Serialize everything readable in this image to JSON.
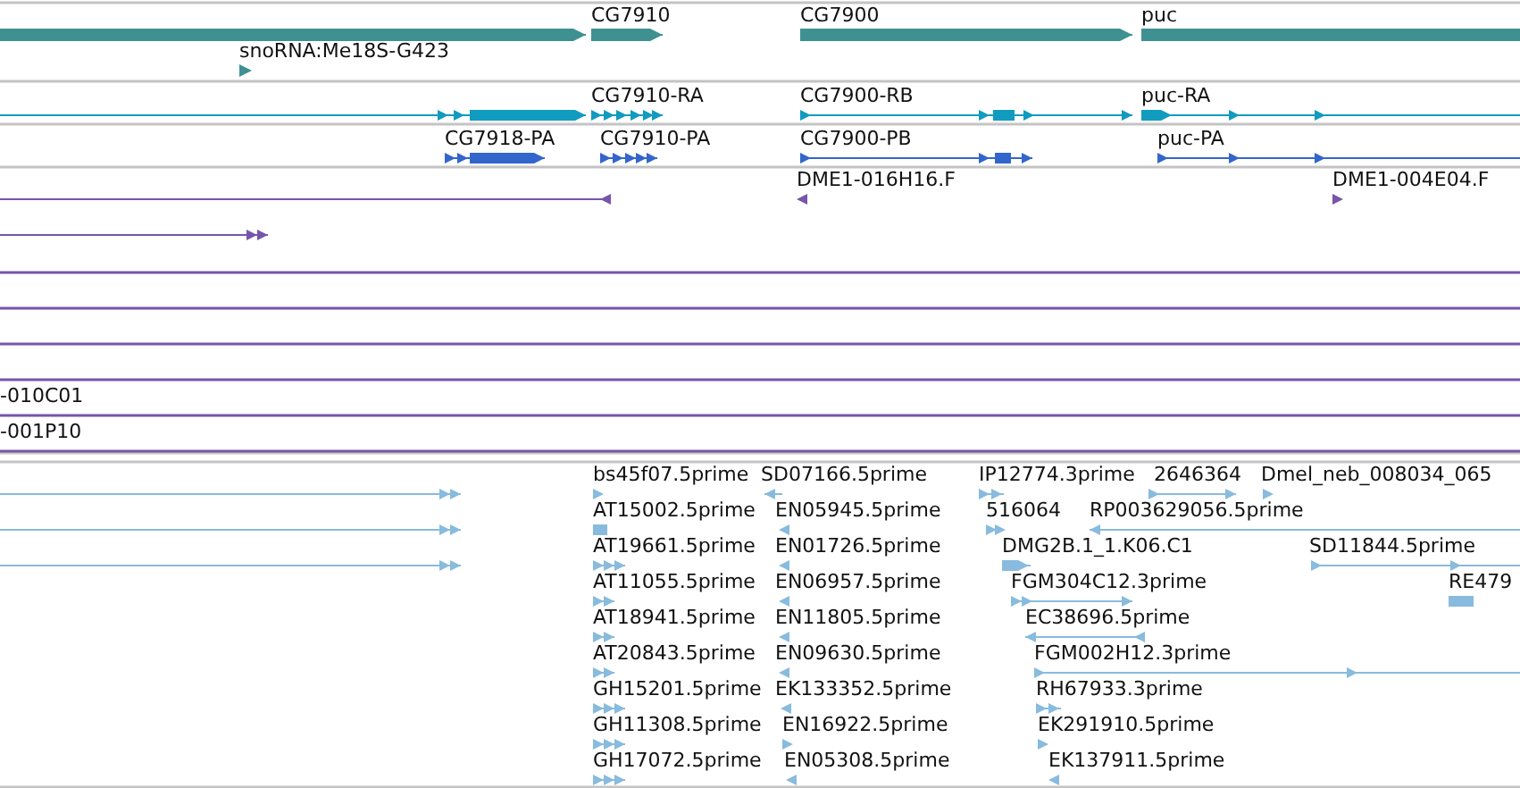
{
  "tracks": [
    {
      "kind": "gene",
      "features": [
        {
          "reverse": false
        },
        {
          "label": "CG7910",
          "reverse": false
        },
        {
          "label": "CG7900",
          "reverse": false
        },
        {
          "label": "puc"
        },
        {
          "label": "snoRNA:Me18S-G423",
          "reverse": false
        }
      ]
    },
    {
      "kind": "transcript",
      "features": [
        {
          "reverse": false
        },
        {
          "label": "CG7910-RA",
          "reverse": false
        },
        {
          "label": "CG7900-RB",
          "reverse": false
        },
        {
          "label": "puc-RA",
          "reverse": false
        }
      ]
    },
    {
      "kind": "protein",
      "features": [
        {
          "label": "CG7918-PA",
          "reverse": false
        },
        {
          "label": "CG7910-PA",
          "reverse": false
        },
        {
          "label": "CG7900-PB",
          "reverse": false
        },
        {
          "label": "puc-PA",
          "reverse": false
        }
      ]
    },
    {
      "kind": "clone",
      "features": [
        {
          "label": "DME1-016H16.F",
          "reverse": true
        },
        {
          "label": "DME1-004E04.F",
          "reverse": false
        },
        {
          "reverse": true
        },
        {
          "reverse": false
        },
        {
          "kind": "span"
        },
        {
          "kind": "span"
        },
        {
          "kind": "span"
        },
        {
          "kind": "span"
        },
        {
          "label": "-010C01",
          "kind": "span"
        },
        {
          "label": "-001P10",
          "kind": "span"
        }
      ]
    },
    {
      "kind": "est",
      "features": [
        {
          "label": "bs45f07.5prime",
          "reverse": false
        },
        {
          "label": "SD07166.5prime",
          "reverse": true
        },
        {
          "label": "IP12774.3prime",
          "reverse": false
        },
        {
          "label": "2646364",
          "reverse": false
        },
        {
          "label": "Dmel_neb_008034_065",
          "reverse": false
        },
        {
          "reverse": false
        },
        {
          "label": "AT15002.5prime"
        },
        {
          "label": "EN05945.5prime",
          "reverse": true
        },
        {
          "label": "516064",
          "reverse": false
        },
        {
          "label": "RP003629056.5prime",
          "reverse": true
        },
        {
          "reverse": false
        },
        {
          "label": "AT19661.5prime",
          "reverse": false
        },
        {
          "label": "EN01726.5prime",
          "reverse": true
        },
        {
          "label": "DMG2B.1_1.K06.C1",
          "reverse": false
        },
        {
          "label": "SD11844.5prime",
          "reverse": false
        },
        {
          "reverse": false
        },
        {
          "label": "AT11055.5prime",
          "reverse": false
        },
        {
          "label": "EN06957.5prime",
          "reverse": true
        },
        {
          "label": "FGM304C12.3prime",
          "reverse": false
        },
        {
          "label": "RE479"
        },
        {
          "label": "AT18941.5prime",
          "reverse": false
        },
        {
          "label": "EN11805.5prime",
          "reverse": true
        },
        {
          "label": "EC38696.5prime",
          "reverse": true
        },
        {
          "label": "AT20843.5prime",
          "reverse": false
        },
        {
          "label": "EN09630.5prime",
          "reverse": true
        },
        {
          "label": "FGM002H12.3prime",
          "reverse": false
        },
        {
          "label": "GH15201.5prime",
          "reverse": false
        },
        {
          "label": "EK133352.5prime",
          "reverse": true
        },
        {
          "label": "RH67933.3prime",
          "reverse": false
        },
        {
          "label": "GH11308.5prime",
          "reverse": false
        },
        {
          "label": "EN16922.5prime",
          "reverse": false
        },
        {
          "label": "EK291910.5prime",
          "reverse": false
        },
        {
          "label": "GH17072.5prime",
          "reverse": false
        },
        {
          "label": "EN05308.5prime",
          "reverse": true
        },
        {
          "label": "EK137911.5prime",
          "reverse": true
        }
      ]
    }
  ]
}
